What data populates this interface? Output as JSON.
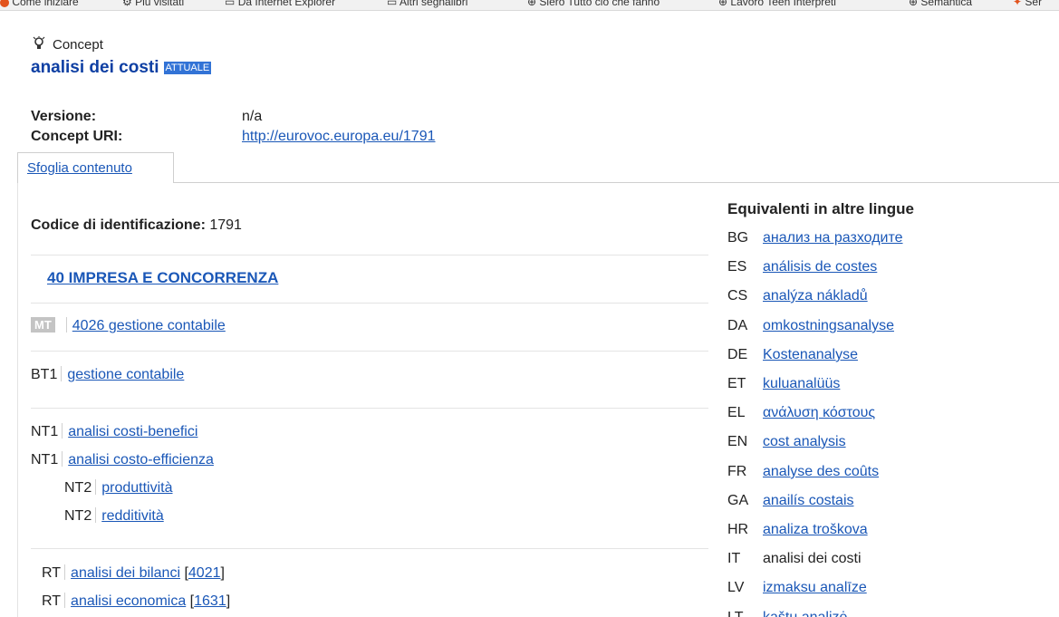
{
  "bookmarks": [
    {
      "label": "Come iniziare",
      "icon": "firefox-icon"
    },
    {
      "label": "Più visitati",
      "icon": "gear-icon"
    },
    {
      "label": "Da Internet Explorer",
      "icon": "folder-icon"
    },
    {
      "label": "Altri segnalibri",
      "icon": "folder-icon"
    },
    {
      "label": "Siero Tutto ciò che fanno",
      "icon": "globe-icon"
    },
    {
      "label": "Lavoro Teen Interpreti",
      "icon": "globe-icon"
    },
    {
      "label": "Semantica",
      "icon": "globe-icon"
    },
    {
      "label": "Ser",
      "icon": "bookmark-icon"
    }
  ],
  "concept": {
    "type_label": "Concept",
    "title": "analisi dei costi",
    "status_badge": "ATTUALE"
  },
  "meta": {
    "version_label": "Versione:",
    "version_value": "n/a",
    "uri_label": "Concept URI:",
    "uri_value": "http://eurovoc.europa.eu/1791"
  },
  "tab": {
    "label": "Sfoglia contenuto"
  },
  "identification": {
    "label": "Codice di identificazione:",
    "value": "1791"
  },
  "domain": {
    "label": "40 IMPRESA E CONCORRENZA"
  },
  "microthesaurus": {
    "badge": "MT",
    "label": "4026 gestione contabile"
  },
  "broader": [
    {
      "rel": "BT1",
      "label": "gestione contabile"
    }
  ],
  "narrower": [
    {
      "rel": "NT1",
      "label": "analisi costi-benefici"
    },
    {
      "rel": "NT1",
      "label": "analisi costo-efficienza"
    },
    {
      "rel": "NT2",
      "label": "produttività"
    },
    {
      "rel": "NT2",
      "label": "redditività"
    }
  ],
  "related": [
    {
      "rel": "RT",
      "label": "analisi dei bilanci",
      "code": "4021"
    },
    {
      "rel": "RT",
      "label": "analisi economica",
      "code": "1631"
    }
  ],
  "equivalents": {
    "title": "Equivalenti in altre lingue",
    "items": [
      {
        "code": "BG",
        "label": "анализ на разходите",
        "link": true
      },
      {
        "code": "ES",
        "label": "análisis de costes",
        "link": true
      },
      {
        "code": "CS",
        "label": "analýza nákladů",
        "link": true
      },
      {
        "code": "DA",
        "label": "omkostningsanalyse",
        "link": true
      },
      {
        "code": "DE",
        "label": "Kostenanalyse",
        "link": true
      },
      {
        "code": "ET",
        "label": "kuluanalüüs",
        "link": true
      },
      {
        "code": "EL",
        "label": "ανάλυση κόστους",
        "link": true
      },
      {
        "code": "EN",
        "label": "cost analysis",
        "link": true
      },
      {
        "code": "FR",
        "label": "analyse des coûts",
        "link": true
      },
      {
        "code": "GA",
        "label": "anailís costais",
        "link": true
      },
      {
        "code": "HR",
        "label": "analiza troškova",
        "link": true
      },
      {
        "code": "IT",
        "label": "analisi dei costi",
        "link": false
      },
      {
        "code": "LV",
        "label": "izmaksu analīze",
        "link": true
      },
      {
        "code": "LT",
        "label": "kaštų analizė",
        "link": true
      }
    ]
  },
  "colors": {
    "link": "#1a57b7",
    "title": "#0e3fa3",
    "badge": "#3273d6"
  }
}
